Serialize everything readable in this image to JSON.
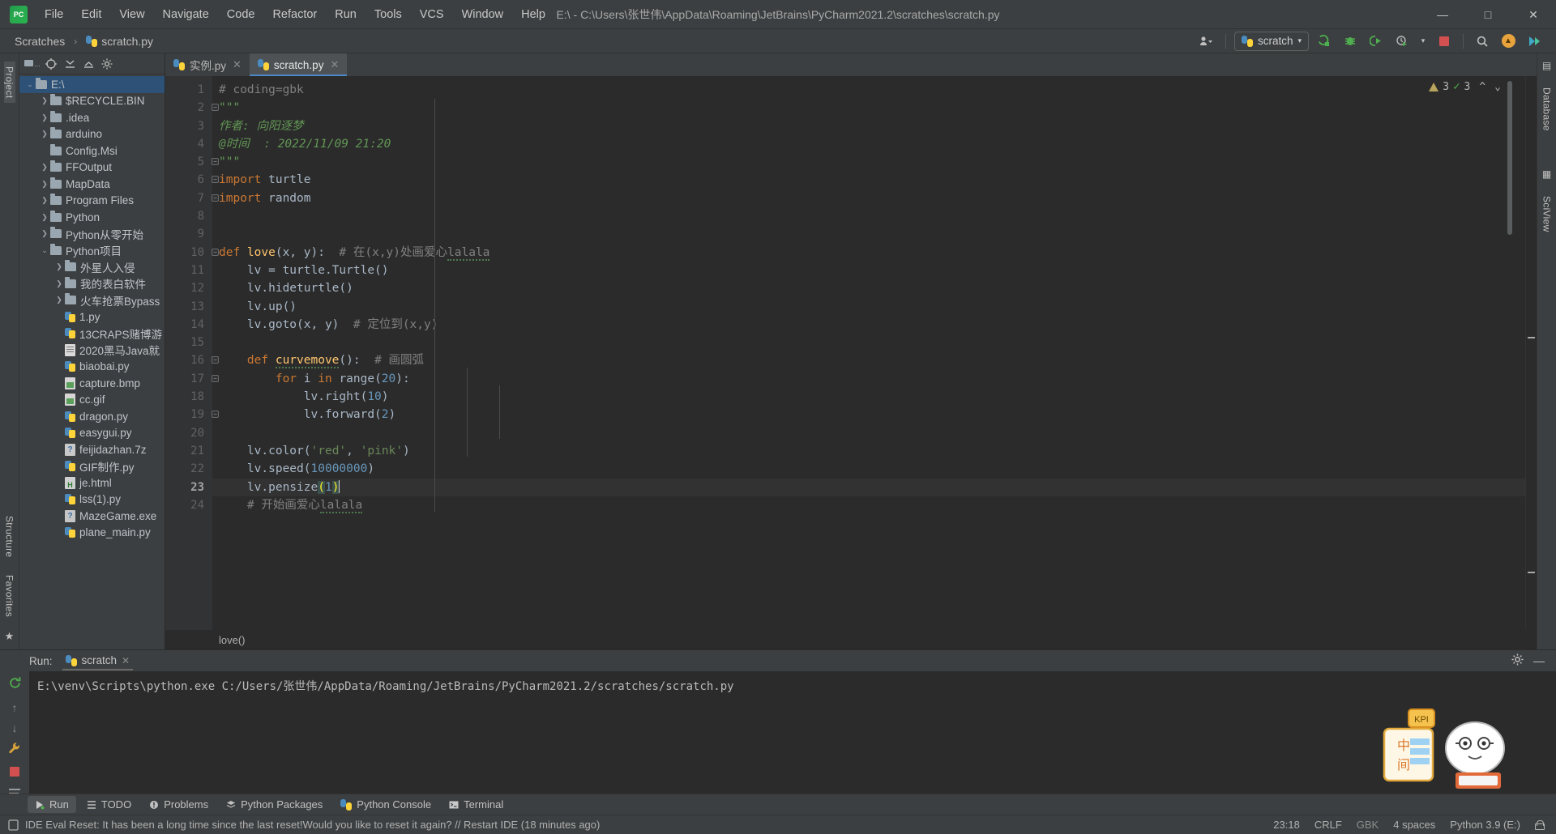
{
  "window": {
    "title": "E:\\ - C:\\Users\\张世伟\\AppData\\Roaming\\JetBrains\\PyCharm2021.2\\scratches\\scratch.py",
    "minimize": "—",
    "maximize": "□",
    "close": "✕"
  },
  "menu": {
    "items": [
      "File",
      "Edit",
      "View",
      "Navigate",
      "Code",
      "Refactor",
      "Run",
      "Tools",
      "VCS",
      "Window",
      "Help"
    ]
  },
  "breadcrumb": {
    "root": "Scratches",
    "separator": "›",
    "file": "scratch.py"
  },
  "nav_right": {
    "account_label": "▾",
    "run_config": "scratch",
    "run_config_caret": "▾",
    "icons": [
      "run-icon",
      "debug-icon",
      "coverage-icon",
      "profile-icon",
      "stop-icon",
      "search-everywhere-icon",
      "update-icon",
      "plugins-icon"
    ]
  },
  "project_panel": {
    "toolbar_icons": [
      "project-scope-icon",
      "locate-icon",
      "expand-all-icon",
      "collapse-all-icon",
      "settings-icon"
    ],
    "tree": [
      {
        "label": "E:\\",
        "type": "folder",
        "depth": 0,
        "arrow": "down",
        "selected": true
      },
      {
        "label": "$RECYCLE.BIN",
        "type": "folder",
        "depth": 1,
        "arrow": "right"
      },
      {
        "label": ".idea",
        "type": "folder",
        "depth": 1,
        "arrow": "right"
      },
      {
        "label": "arduino",
        "type": "folder",
        "depth": 1,
        "arrow": "right"
      },
      {
        "label": "Config.Msi",
        "type": "folder",
        "depth": 1,
        "arrow": "none"
      },
      {
        "label": "FFOutput",
        "type": "folder",
        "depth": 1,
        "arrow": "right"
      },
      {
        "label": "MapData",
        "type": "folder",
        "depth": 1,
        "arrow": "right"
      },
      {
        "label": "Program Files",
        "type": "folder",
        "depth": 1,
        "arrow": "right"
      },
      {
        "label": "Python",
        "type": "folder",
        "depth": 1,
        "arrow": "right"
      },
      {
        "label": "Python从零开始",
        "type": "folder",
        "depth": 1,
        "arrow": "right"
      },
      {
        "label": "Python项目",
        "type": "folder",
        "depth": 1,
        "arrow": "down"
      },
      {
        "label": "外星人入侵",
        "type": "folder",
        "depth": 2,
        "arrow": "right"
      },
      {
        "label": "我的表白软件",
        "type": "folder",
        "depth": 2,
        "arrow": "right"
      },
      {
        "label": "火车抢票Bypass",
        "type": "folder",
        "depth": 2,
        "arrow": "right"
      },
      {
        "label": "1.py",
        "type": "py",
        "depth": 2,
        "arrow": "none"
      },
      {
        "label": "13CRAPS赌博游",
        "type": "py",
        "depth": 2,
        "arrow": "none"
      },
      {
        "label": "2020黑马Java就",
        "type": "txt",
        "depth": 2,
        "arrow": "none"
      },
      {
        "label": "biaobai.py",
        "type": "py",
        "depth": 2,
        "arrow": "none"
      },
      {
        "label": "capture.bmp",
        "type": "img",
        "depth": 2,
        "arrow": "none"
      },
      {
        "label": "cc.gif",
        "type": "img",
        "depth": 2,
        "arrow": "none"
      },
      {
        "label": "dragon.py",
        "type": "py",
        "depth": 2,
        "arrow": "none"
      },
      {
        "label": "easygui.py",
        "type": "py",
        "depth": 2,
        "arrow": "none"
      },
      {
        "label": "feijidazhan.7z",
        "type": "gen",
        "depth": 2,
        "arrow": "none"
      },
      {
        "label": "GIF制作.py",
        "type": "py",
        "depth": 2,
        "arrow": "none"
      },
      {
        "label": "je.html",
        "type": "html",
        "depth": 2,
        "arrow": "none"
      },
      {
        "label": "lss(1).py",
        "type": "py",
        "depth": 2,
        "arrow": "none"
      },
      {
        "label": "MazeGame.exe",
        "type": "exe",
        "depth": 2,
        "arrow": "none"
      },
      {
        "label": "plane_main.py",
        "type": "py",
        "depth": 2,
        "arrow": "none"
      }
    ]
  },
  "left_rail": {
    "top_label": "Project",
    "bottom_labels": [
      "Structure",
      "Favorites"
    ]
  },
  "right_rail": {
    "labels": [
      "Database",
      "SciView"
    ]
  },
  "tabs": [
    {
      "label": "实例.py",
      "active": false,
      "close": "✕"
    },
    {
      "label": "scratch.py",
      "active": true,
      "close": "✕"
    }
  ],
  "inspections": {
    "warning_count": "3",
    "ok_count": "3",
    "up_arrow": "^",
    "down_arrow": "⌄"
  },
  "editor": {
    "lines": [
      {
        "n": "1",
        "fold": "none",
        "cur": false
      },
      {
        "n": "2",
        "fold": "open",
        "cur": false
      },
      {
        "n": "3",
        "fold": "none",
        "cur": false
      },
      {
        "n": "4",
        "fold": "none",
        "cur": false
      },
      {
        "n": "5",
        "fold": "close",
        "cur": false
      },
      {
        "n": "6",
        "fold": "open",
        "cur": false
      },
      {
        "n": "7",
        "fold": "close",
        "cur": false
      },
      {
        "n": "8",
        "fold": "none",
        "cur": false
      },
      {
        "n": "9",
        "fold": "none",
        "cur": false
      },
      {
        "n": "10",
        "fold": "open",
        "cur": false
      },
      {
        "n": "11",
        "fold": "none",
        "cur": false
      },
      {
        "n": "12",
        "fold": "none",
        "cur": false
      },
      {
        "n": "13",
        "fold": "none",
        "cur": false
      },
      {
        "n": "14",
        "fold": "none",
        "cur": false
      },
      {
        "n": "15",
        "fold": "none",
        "cur": false
      },
      {
        "n": "16",
        "fold": "open",
        "cur": false
      },
      {
        "n": "17",
        "fold": "open",
        "cur": false
      },
      {
        "n": "18",
        "fold": "none",
        "cur": false
      },
      {
        "n": "19",
        "fold": "close",
        "cur": false
      },
      {
        "n": "20",
        "fold": "none",
        "cur": false
      },
      {
        "n": "21",
        "fold": "none",
        "cur": false
      },
      {
        "n": "22",
        "fold": "none",
        "cur": false
      },
      {
        "n": "23",
        "fold": "none",
        "cur": true
      },
      {
        "n": "24",
        "fold": "none",
        "cur": false
      }
    ],
    "code_text": [
      "# coding=gbk",
      "\"\"\"",
      "作者: 向阳逐梦",
      "@时间  : 2022/11/09 21:20",
      "\"\"\"",
      "import turtle",
      "import random",
      "",
      "",
      "def love(x, y):  # 在(x,y)处画爱心lalala",
      "    lv = turtle.Turtle()",
      "    lv.hideturtle()",
      "    lv.up()",
      "    lv.goto(x, y)  # 定位到(x,y)",
      "",
      "  def curvemove():  # 画圆弧",
      "      for i in range(20):",
      "          lv.right(10)",
      "          lv.forward(2)",
      "",
      "    lv.color('red', 'pink')",
      "    lv.speed(10000000)",
      "    lv.pensize(1)",
      "    # 开始画爱心lalala"
    ],
    "footer_crumb": "love()"
  },
  "run_panel": {
    "label": "Run:",
    "tab": "scratch",
    "tab_close": "✕",
    "console_line": "E:\\venv\\Scripts\\python.exe C:/Users/张世伟/AppData/Roaming/JetBrains/PyCharm2021.2/scratches/scratch.py",
    "side_icons": [
      "rerun-icon",
      "up-arrow-icon",
      "down-arrow-icon",
      "stop-icon",
      "soft-wrap-icon"
    ],
    "header_icons": [
      "settings-icon",
      "hide-icon"
    ]
  },
  "tool_window_bar": {
    "items": [
      {
        "label": "Run",
        "icon": "run-icon",
        "active": true
      },
      {
        "label": "TODO",
        "icon": "todo-icon",
        "active": false
      },
      {
        "label": "Problems",
        "icon": "problems-icon",
        "active": false
      },
      {
        "label": "Python Packages",
        "icon": "packages-icon",
        "active": false
      },
      {
        "label": "Python Console",
        "icon": "python-console-icon",
        "active": false
      },
      {
        "label": "Terminal",
        "icon": "terminal-icon",
        "active": false
      }
    ]
  },
  "statusbar": {
    "message": "IDE Eval Reset: It has been a long time since the last reset!Would you like to reset it again? // Restart IDE (18 minutes ago)",
    "time": "23:18",
    "line_sep": "CRLF",
    "encoding": "GBK",
    "indent": "4 spaces",
    "interpreter": "Python 3.9 (E:)",
    "lock_icon": "unlocked-icon"
  },
  "colors": {
    "accent": "#4a88c7",
    "selection": "#2d5177",
    "keyword": "#cc7832",
    "string": "#6a8759",
    "number": "#6897bb",
    "comment": "#808080",
    "docstring": "#629755",
    "function": "#ffc66d",
    "warning": "#b8a45c",
    "ok": "#4fae4f"
  }
}
